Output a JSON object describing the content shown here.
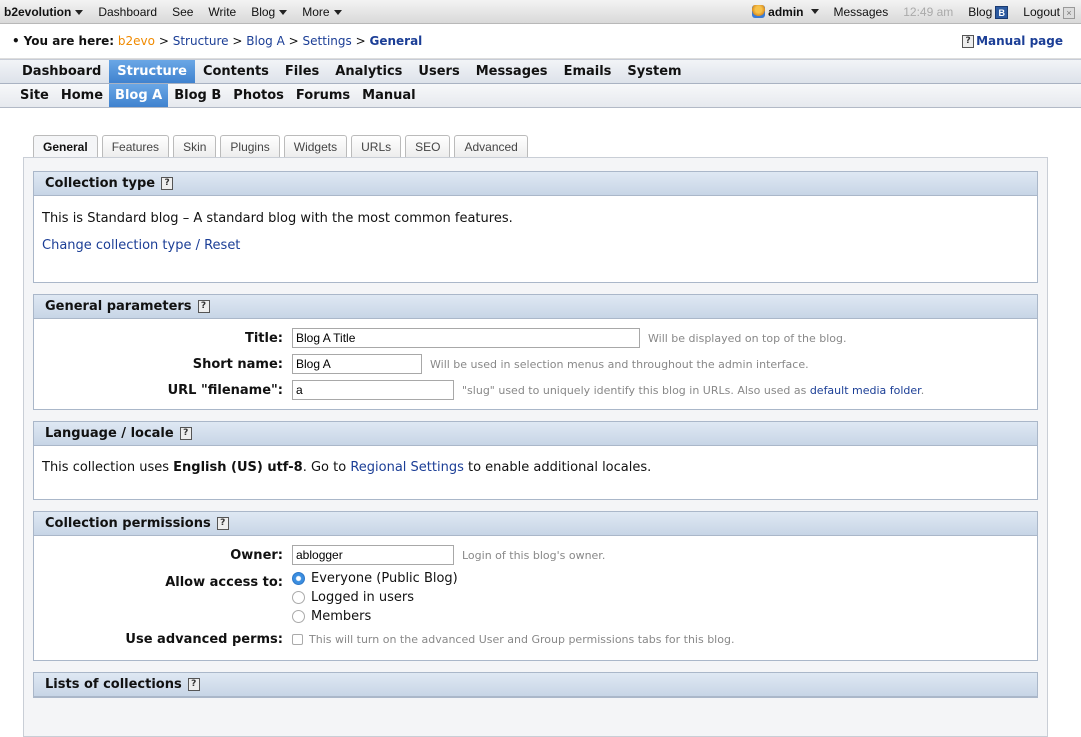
{
  "evobar": {
    "brand": "b2evolution",
    "left_items": [
      "Dashboard",
      "See",
      "Write",
      "Blog",
      "More"
    ],
    "user": "admin",
    "messages": "Messages",
    "time": "12:49 am",
    "blog": "Blog",
    "blog_badge": "B",
    "logout": "Logout"
  },
  "breadcrumb": {
    "prefix": "You are here:",
    "items": [
      "b2evo",
      "Structure",
      "Blog A",
      "Settings"
    ],
    "current": "General",
    "sep": ">",
    "manual": "Manual page"
  },
  "menu1": [
    "Dashboard",
    "Structure",
    "Contents",
    "Files",
    "Analytics",
    "Users",
    "Messages",
    "Emails",
    "System"
  ],
  "menu2": [
    "Site",
    "Home",
    "Blog A",
    "Blog B",
    "Photos",
    "Forums",
    "Manual"
  ],
  "tabs": [
    "General",
    "Features",
    "Skin",
    "Plugins",
    "Widgets",
    "URLs",
    "SEO",
    "Advanced"
  ],
  "collection_type": {
    "title": "Collection type",
    "text": "This is Standard blog – A standard blog with the most common features.",
    "link": "Change collection type / Reset"
  },
  "general_params": {
    "title": "General parameters",
    "title_label": "Title:",
    "title_value": "Blog A Title",
    "title_note": "Will be displayed on top of the blog.",
    "short_label": "Short name:",
    "short_value": "Blog A",
    "short_note": "Will be used in selection menus and throughout the admin interface.",
    "url_label": "URL \"filename\":",
    "url_value": "a",
    "url_note": "\"slug\" used to uniquely identify this blog in URLs. Also used as",
    "url_note_link": "default media folder",
    "url_note_end": "."
  },
  "locale": {
    "title": "Language / locale",
    "text_a": "This collection uses",
    "locale": "English (US) utf-8",
    "text_b": ". Go to",
    "link": "Regional Settings",
    "text_c": "to enable additional locales."
  },
  "permissions": {
    "title": "Collection permissions",
    "owner_label": "Owner:",
    "owner_value": "ablogger",
    "owner_note": "Login of this blog's owner.",
    "access_label": "Allow access to:",
    "options": [
      "Everyone (Public Blog)",
      "Logged in users",
      "Members"
    ],
    "selected": "Everyone (Public Blog)",
    "adv_label": "Use advanced perms:",
    "adv_note": "This will turn on the advanced User and Group permissions tabs for this blog."
  },
  "lists": {
    "title": "Lists of collections"
  },
  "icons": {
    "help": "?",
    "close": "×"
  },
  "colors": {
    "selected_menu": "#3f82cf",
    "link": "#1b3e96",
    "home_crumb": "#f08a00"
  }
}
